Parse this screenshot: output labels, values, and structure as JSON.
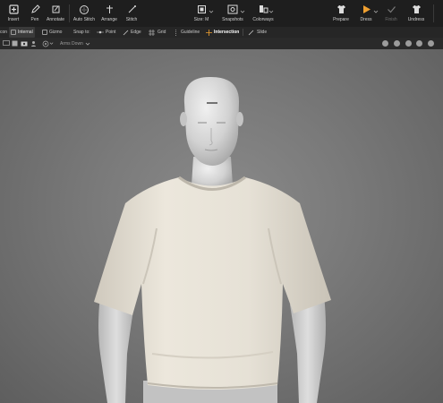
{
  "toolbar": {
    "insert": "Insert",
    "pen": "Pen",
    "annotate": "Annotate",
    "auto_stitch": "Auto Stitch",
    "arrange": "Arrange",
    "stitch": "Stitch",
    "size": "Size: M",
    "snapshots": "Snapshots",
    "colorways": "Colorways",
    "prepare": "Prepare",
    "dress": "Dress",
    "finish": "Finish",
    "undress": "Undress"
  },
  "subbar": {
    "partial_left": "con",
    "internal": "Internal",
    "gizmo": "Gizmo",
    "snap_to": "Snap to:",
    "point": "Point",
    "edge": "Edge",
    "grid": "Grid",
    "guideline": "Guideline",
    "intersection": "Intersection",
    "slide": "Slide"
  },
  "thirdbar": {
    "pose": "Arms Down"
  },
  "colors": {
    "toolbar_bg": "#1e1e1e",
    "accent_orange": "#f0a030",
    "viewport_bg": "#7a7a7a",
    "garment": "#e4dfd4",
    "skin": "#d8d8d8"
  }
}
